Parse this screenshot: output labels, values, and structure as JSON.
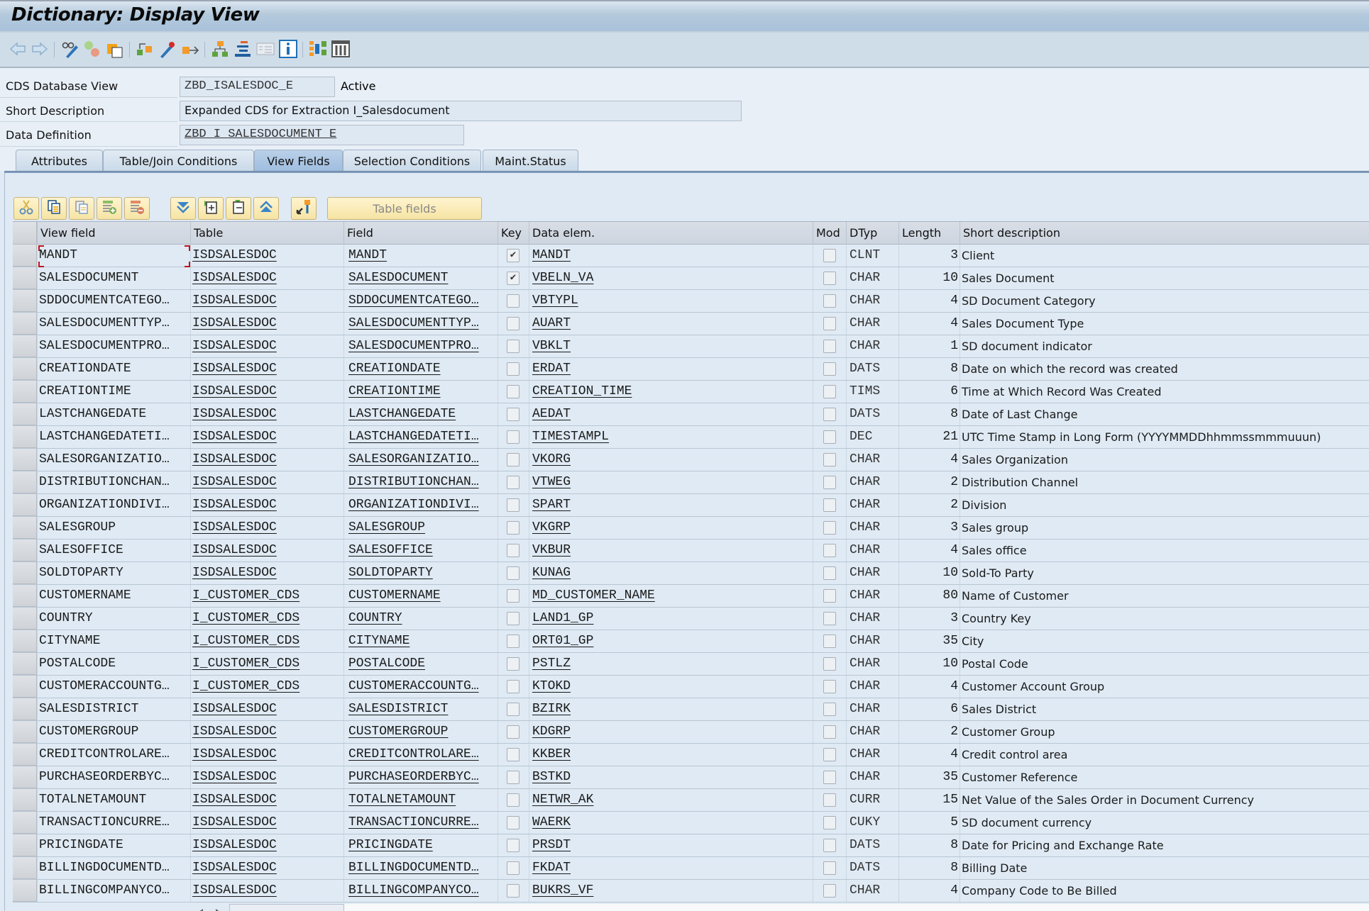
{
  "window": {
    "title": "Dictionary: Display View"
  },
  "toolbar": {
    "icons": [
      "back-arrow-icon",
      "forward-arrow-icon",
      "display-change-icon",
      "active-inactive-icon",
      "other-object-icon",
      "where-used-icon",
      "activate-icon",
      "navigate-icon",
      "hierarchy-icon",
      "display-object-list-icon",
      "object-list-icon",
      "info-icon",
      "layout-icon",
      "columns-icon"
    ]
  },
  "header": {
    "cds_view_label": "CDS Database View",
    "cds_view_value": "ZBD_ISALESDOC_E",
    "status": "Active",
    "short_desc_label": "Short Description",
    "short_desc_value": "Expanded CDS for Extraction I_Salesdocument",
    "data_def_label": "Data Definition",
    "data_def_value": "ZBD_I_SALESDOCUMENT_E"
  },
  "tabs": [
    {
      "label": "Attributes",
      "active": false
    },
    {
      "label": "Table/Join Conditions",
      "active": false
    },
    {
      "label": "View Fields",
      "active": true
    },
    {
      "label": "Selection Conditions",
      "active": false
    },
    {
      "label": "Maint.Status",
      "active": false
    }
  ],
  "grid_toolbar": {
    "buttons": [
      "cut-icon",
      "copy-icon",
      "paste-icon",
      "insert-row-icon",
      "delete-row-icon",
      "select-all-icon",
      "expand-icon",
      "collapse-icon",
      "deselect-all-icon",
      "key-icon"
    ],
    "table_fields_label": "Table fields"
  },
  "grid": {
    "columns": [
      "View field",
      "Table",
      "Field",
      "Key",
      "Data elem.",
      "Mod",
      "DTyp",
      "Length",
      "Short description"
    ],
    "rows": [
      {
        "view_field": "MANDT",
        "table": "ISDSALESDOC",
        "field": "MANDT",
        "key": true,
        "data_elem": "MANDT",
        "mod": false,
        "dtyp": "CLNT",
        "length": "3",
        "desc": "Client"
      },
      {
        "view_field": "SALESDOCUMENT",
        "table": "ISDSALESDOC",
        "field": "SALESDOCUMENT",
        "key": true,
        "data_elem": "VBELN_VA",
        "mod": false,
        "dtyp": "CHAR",
        "length": "10",
        "desc": "Sales Document"
      },
      {
        "view_field": "SDDOCUMENTCATEGO…",
        "table": "ISDSALESDOC",
        "field": "SDDOCUMENTCATEGO…",
        "key": false,
        "data_elem": "VBTYPL",
        "mod": false,
        "dtyp": "CHAR",
        "length": "4",
        "desc": "SD Document Category"
      },
      {
        "view_field": "SALESDOCUMENTTYP…",
        "table": "ISDSALESDOC",
        "field": "SALESDOCUMENTTYP…",
        "key": false,
        "data_elem": "AUART",
        "mod": false,
        "dtyp": "CHAR",
        "length": "4",
        "desc": "Sales Document Type"
      },
      {
        "view_field": "SALESDOCUMENTPRO…",
        "table": "ISDSALESDOC",
        "field": "SALESDOCUMENTPRO…",
        "key": false,
        "data_elem": "VBKLT",
        "mod": false,
        "dtyp": "CHAR",
        "length": "1",
        "desc": "SD document indicator"
      },
      {
        "view_field": "CREATIONDATE",
        "table": "ISDSALESDOC",
        "field": "CREATIONDATE",
        "key": false,
        "data_elem": "ERDAT",
        "mod": false,
        "dtyp": "DATS",
        "length": "8",
        "desc": "Date on which the record was created"
      },
      {
        "view_field": "CREATIONTIME",
        "table": "ISDSALESDOC",
        "field": "CREATIONTIME",
        "key": false,
        "data_elem": "CREATION_TIME",
        "mod": false,
        "dtyp": "TIMS",
        "length": "6",
        "desc": "Time at Which Record Was Created"
      },
      {
        "view_field": "LASTCHANGEDATE",
        "table": "ISDSALESDOC",
        "field": "LASTCHANGEDATE",
        "key": false,
        "data_elem": "AEDAT",
        "mod": false,
        "dtyp": "DATS",
        "length": "8",
        "desc": "Date of Last Change"
      },
      {
        "view_field": "LASTCHANGEDATETI…",
        "table": "ISDSALESDOC",
        "field": "LASTCHANGEDATETI…",
        "key": false,
        "data_elem": "TIMESTAMPL",
        "mod": false,
        "dtyp": "DEC",
        "length": "21",
        "desc": "UTC Time Stamp in Long Form (YYYYMMDDhhmmssmmmuuun)"
      },
      {
        "view_field": "SALESORGANIZATIO…",
        "table": "ISDSALESDOC",
        "field": "SALESORGANIZATIO…",
        "key": false,
        "data_elem": "VKORG",
        "mod": false,
        "dtyp": "CHAR",
        "length": "4",
        "desc": "Sales Organization"
      },
      {
        "view_field": "DISTRIBUTIONCHAN…",
        "table": "ISDSALESDOC",
        "field": "DISTRIBUTIONCHAN…",
        "key": false,
        "data_elem": "VTWEG",
        "mod": false,
        "dtyp": "CHAR",
        "length": "2",
        "desc": "Distribution Channel"
      },
      {
        "view_field": "ORGANIZATIONDIVI…",
        "table": "ISDSALESDOC",
        "field": "ORGANIZATIONDIVI…",
        "key": false,
        "data_elem": "SPART",
        "mod": false,
        "dtyp": "CHAR",
        "length": "2",
        "desc": "Division"
      },
      {
        "view_field": "SALESGROUP",
        "table": "ISDSALESDOC",
        "field": "SALESGROUP",
        "key": false,
        "data_elem": "VKGRP",
        "mod": false,
        "dtyp": "CHAR",
        "length": "3",
        "desc": "Sales group"
      },
      {
        "view_field": "SALESOFFICE",
        "table": "ISDSALESDOC",
        "field": "SALESOFFICE",
        "key": false,
        "data_elem": "VKBUR",
        "mod": false,
        "dtyp": "CHAR",
        "length": "4",
        "desc": "Sales office"
      },
      {
        "view_field": "SOLDTOPARTY",
        "table": "ISDSALESDOC",
        "field": "SOLDTOPARTY",
        "key": false,
        "data_elem": "KUNAG",
        "mod": false,
        "dtyp": "CHAR",
        "length": "10",
        "desc": "Sold-To Party"
      },
      {
        "view_field": "CUSTOMERNAME",
        "table": "I_CUSTOMER_CDS",
        "field": "CUSTOMERNAME",
        "key": false,
        "data_elem": "MD_CUSTOMER_NAME",
        "mod": false,
        "dtyp": "CHAR",
        "length": "80",
        "desc": "Name of Customer"
      },
      {
        "view_field": "COUNTRY",
        "table": "I_CUSTOMER_CDS",
        "field": "COUNTRY",
        "key": false,
        "data_elem": "LAND1_GP",
        "mod": false,
        "dtyp": "CHAR",
        "length": "3",
        "desc": "Country Key"
      },
      {
        "view_field": "CITYNAME",
        "table": "I_CUSTOMER_CDS",
        "field": "CITYNAME",
        "key": false,
        "data_elem": "ORT01_GP",
        "mod": false,
        "dtyp": "CHAR",
        "length": "35",
        "desc": "City"
      },
      {
        "view_field": "POSTALCODE",
        "table": "I_CUSTOMER_CDS",
        "field": "POSTALCODE",
        "key": false,
        "data_elem": "PSTLZ",
        "mod": false,
        "dtyp": "CHAR",
        "length": "10",
        "desc": "Postal Code"
      },
      {
        "view_field": "CUSTOMERACCOUNTG…",
        "table": "I_CUSTOMER_CDS",
        "field": "CUSTOMERACCOUNTG…",
        "key": false,
        "data_elem": "KTOKD",
        "mod": false,
        "dtyp": "CHAR",
        "length": "4",
        "desc": "Customer Account Group"
      },
      {
        "view_field": "SALESDISTRICT",
        "table": "ISDSALESDOC",
        "field": "SALESDISTRICT",
        "key": false,
        "data_elem": "BZIRK",
        "mod": false,
        "dtyp": "CHAR",
        "length": "6",
        "desc": "Sales District"
      },
      {
        "view_field": "CUSTOMERGROUP",
        "table": "ISDSALESDOC",
        "field": "CUSTOMERGROUP",
        "key": false,
        "data_elem": "KDGRP",
        "mod": false,
        "dtyp": "CHAR",
        "length": "2",
        "desc": "Customer Group"
      },
      {
        "view_field": "CREDITCONTROLARE…",
        "table": "ISDSALESDOC",
        "field": "CREDITCONTROLARE…",
        "key": false,
        "data_elem": "KKBER",
        "mod": false,
        "dtyp": "CHAR",
        "length": "4",
        "desc": "Credit control area"
      },
      {
        "view_field": "PURCHASEORDERBYC…",
        "table": "ISDSALESDOC",
        "field": "PURCHASEORDERBYC…",
        "key": false,
        "data_elem": "BSTKD",
        "mod": false,
        "dtyp": "CHAR",
        "length": "35",
        "desc": "Customer Reference"
      },
      {
        "view_field": "TOTALNETAMOUNT",
        "table": "ISDSALESDOC",
        "field": "TOTALNETAMOUNT",
        "key": false,
        "data_elem": "NETWR_AK",
        "mod": false,
        "dtyp": "CURR",
        "length": "15",
        "desc": "Net Value of the Sales Order in Document Currency"
      },
      {
        "view_field": "TRANSACTIONCURRE…",
        "table": "ISDSALESDOC",
        "field": "TRANSACTIONCURRE…",
        "key": false,
        "data_elem": "WAERK",
        "mod": false,
        "dtyp": "CUKY",
        "length": "5",
        "desc": "SD document currency"
      },
      {
        "view_field": "PRICINGDATE",
        "table": "ISDSALESDOC",
        "field": "PRICINGDATE",
        "key": false,
        "data_elem": "PRSDT",
        "mod": false,
        "dtyp": "DATS",
        "length": "8",
        "desc": "Date for Pricing and Exchange Rate"
      },
      {
        "view_field": "BILLINGDOCUMENTD…",
        "table": "ISDSALESDOC",
        "field": "BILLINGDOCUMENTD…",
        "key": false,
        "data_elem": "FKDAT",
        "mod": false,
        "dtyp": "DATS",
        "length": "8",
        "desc": "Billing Date"
      },
      {
        "view_field": "BILLINGCOMPANYCO…",
        "table": "ISDSALESDOC",
        "field": "BILLINGCOMPANYCO…",
        "key": false,
        "data_elem": "BUKRS_VF",
        "mod": false,
        "dtyp": "CHAR",
        "length": "4",
        "desc": "Company Code to Be Billed"
      }
    ]
  },
  "colors": {
    "title_bar": "#a9c2da",
    "toolbar": "#cfdde8",
    "grid_bg": "#dfeaf4",
    "button_bg": "#f6e4a4",
    "active_tab": "#9fbde0",
    "focus_marker": "#c0141c"
  }
}
